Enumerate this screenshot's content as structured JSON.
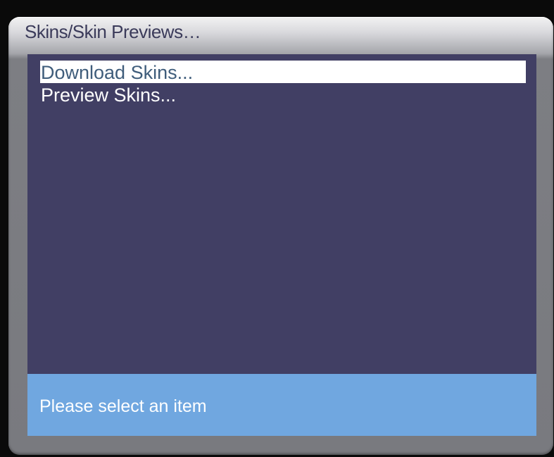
{
  "dialog": {
    "title": "Skins/Skin Previews…"
  },
  "menu": {
    "items": [
      {
        "label": "Download Skins...",
        "selected": true
      },
      {
        "label": "Preview Skins...",
        "selected": false
      }
    ]
  },
  "status": {
    "text": "Please select an item"
  },
  "colors": {
    "panel_background": "#413f64",
    "selection_background": "#ffffff",
    "selected_text": "#3f5d7b",
    "status_background": "#70a7e0",
    "frame": "#797a7f"
  }
}
